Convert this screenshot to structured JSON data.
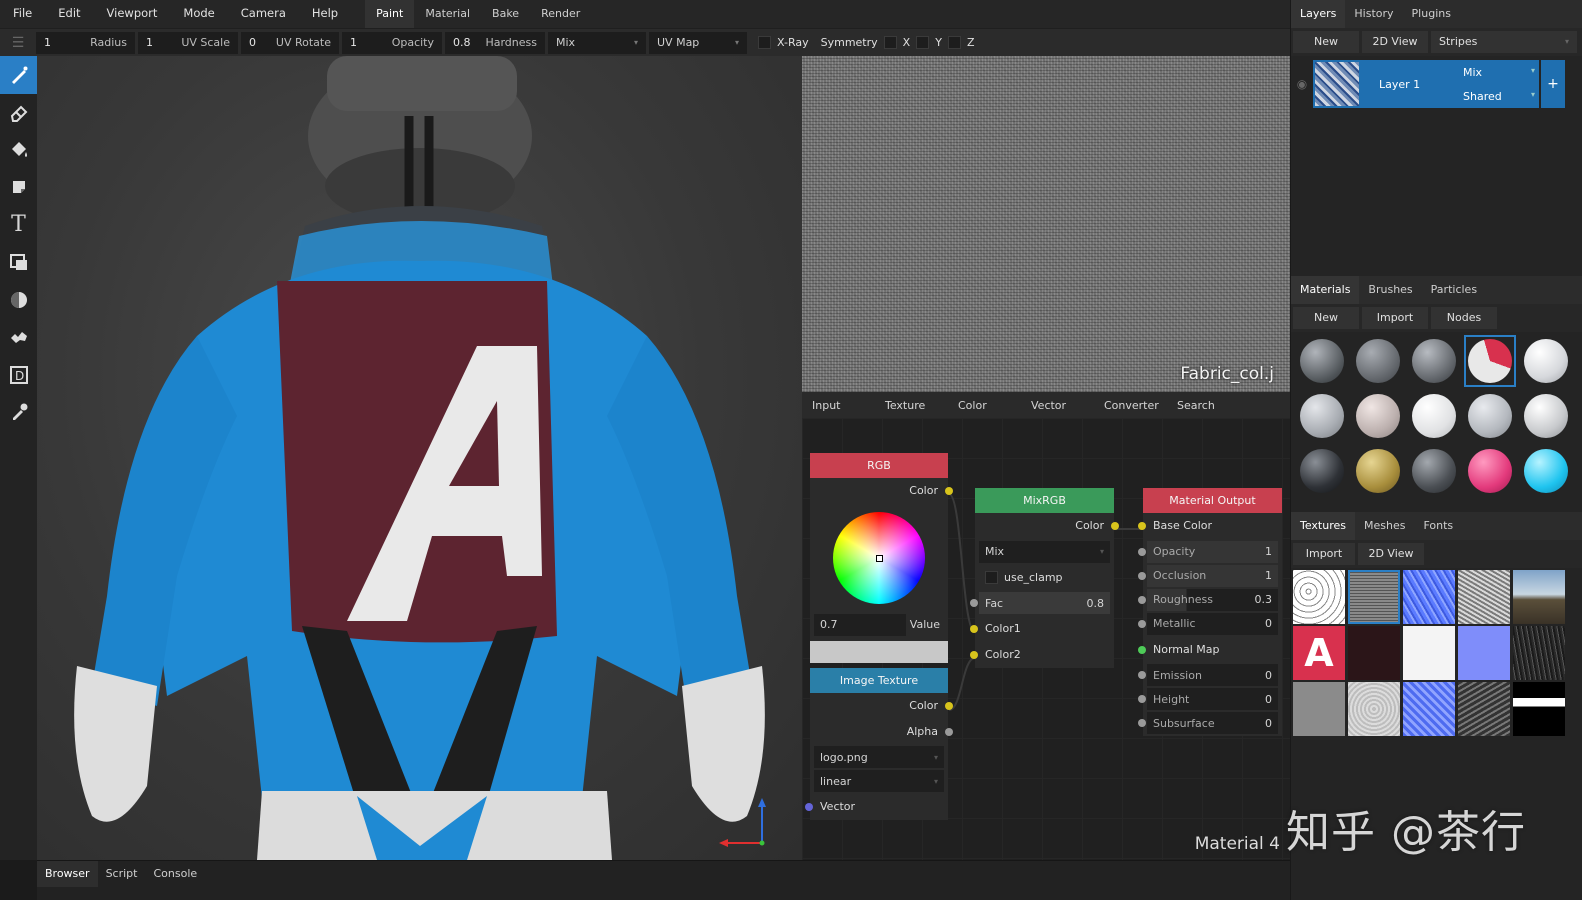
{
  "menu": {
    "items": [
      "File",
      "Edit",
      "Viewport",
      "Mode",
      "Camera",
      "Help"
    ],
    "workspace_tabs": [
      "Paint",
      "Material",
      "Bake",
      "Render"
    ],
    "active_tab": "Paint"
  },
  "toolbar": {
    "radius": {
      "value": "1",
      "label": "Radius"
    },
    "uv_scale": {
      "value": "1",
      "label": "UV Scale"
    },
    "uv_rotate": {
      "value": "0",
      "label": "UV Rotate"
    },
    "opacity": {
      "value": "1",
      "label": "Opacity"
    },
    "hardness": {
      "value": "0.8",
      "label": "Hardness"
    },
    "blend_mode": "Mix",
    "uv_source": "UV Map",
    "xray_label": "X-Ray",
    "symmetry_label": "Symmetry",
    "sym_x": "X",
    "sym_y": "Y",
    "sym_z": "Z"
  },
  "tools": [
    "brush-icon",
    "eraser-icon",
    "fill-icon",
    "decal-icon",
    "text-icon",
    "clone-icon",
    "blur-icon",
    "particle-icon",
    "bake-icon",
    "picker-icon"
  ],
  "texture_view": {
    "filename": "Fabric_col.j"
  },
  "node_categories": [
    "Input",
    "Texture",
    "Color",
    "Vector",
    "Converter",
    "Search"
  ],
  "nodes": {
    "rgb": {
      "title": "RGB",
      "out_color": "Color",
      "value": "0.7",
      "value_label": "Value"
    },
    "image_texture": {
      "title": "Image Texture",
      "out_color": "Color",
      "out_alpha": "Alpha",
      "file": "logo.png",
      "interp": "linear",
      "in_vector": "Vector"
    },
    "mixrgb": {
      "title": "MixRGB",
      "out_color": "Color",
      "blend": "Mix",
      "clamp_label": "use_clamp",
      "fac_label": "Fac",
      "fac_value": "0.8",
      "in1": "Color1",
      "in2": "Color2"
    },
    "output": {
      "title": "Material Output",
      "base_color": "Base Color",
      "opacity": {
        "label": "Opacity",
        "value": "1"
      },
      "occlusion": {
        "label": "Occlusion",
        "value": "1"
      },
      "roughness": {
        "label": "Roughness",
        "value": "0.3"
      },
      "metallic": {
        "label": "Metallic",
        "value": "0"
      },
      "normal_map": "Normal Map",
      "emission": {
        "label": "Emission",
        "value": "0"
      },
      "height": {
        "label": "Height",
        "value": "0"
      },
      "subsurface": {
        "label": "Subsurface",
        "value": "0"
      }
    },
    "material_name": "Material 4"
  },
  "layers_panel": {
    "tabs": [
      "Layers",
      "History",
      "Plugins"
    ],
    "buttons": {
      "new": "New",
      "view2d": "2D View",
      "pattern": "Stripes"
    },
    "layer": {
      "name": "Layer 1",
      "blend": "Mix",
      "mode": "Shared"
    }
  },
  "materials_panel": {
    "tabs": [
      "Materials",
      "Brushes",
      "Particles"
    ],
    "buttons": [
      "New",
      "Import",
      "Nodes"
    ]
  },
  "textures_panel": {
    "tabs": [
      "Textures",
      "Meshes",
      "Fonts"
    ],
    "buttons": [
      "Import",
      "2D View"
    ]
  },
  "bottom_tabs": [
    "Browser",
    "Script",
    "Console"
  ],
  "watermark": "知乎 @茶行",
  "colors": {
    "accent": "#2a7fc6",
    "rgb_header": "#c8404f",
    "mix_header": "#3a9a5a",
    "output_header": "#c8404f",
    "image_header": "#2a7fa8"
  }
}
